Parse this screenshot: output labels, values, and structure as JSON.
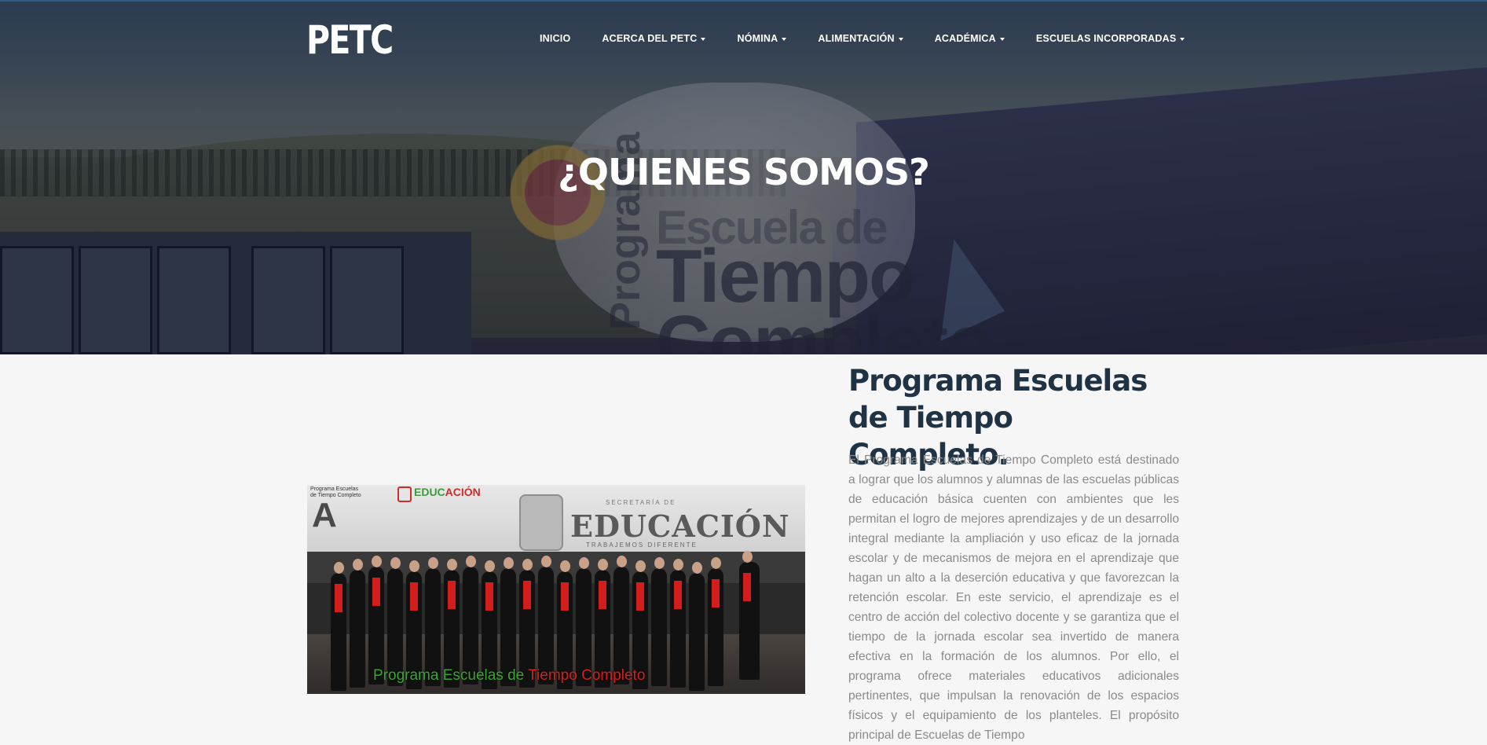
{
  "header": {
    "logo": "PETC",
    "nav": [
      {
        "label": "INICIO",
        "dropdown": false
      },
      {
        "label": "ACERCA DEL PETC",
        "dropdown": true
      },
      {
        "label": "NÓMINA",
        "dropdown": true
      },
      {
        "label": "ALIMENTACIÓN",
        "dropdown": true
      },
      {
        "label": "ACADÉMICA",
        "dropdown": true
      },
      {
        "label": "ESCUELAS INCORPORADAS",
        "dropdown": true
      }
    ]
  },
  "hero": {
    "heading": "¿QUIENES SOMOS?",
    "sign_line1": "Escuela de",
    "sign_line2": "Tiempo",
    "sign_line3": "Completo",
    "sign_side": "Programa"
  },
  "photo": {
    "brand_text_green": "EDUC",
    "brand_text_red": "ACIÓN",
    "corner_label": "Programa Escuelas de Tiempo Completo",
    "letter": "A",
    "secretaria": "SECRETARÍA DE",
    "building_sign": "EDUCACIÓN",
    "building_subtitle": "TRABAJEMOS DIFERENTE",
    "caption_green": "Programa Escuelas de",
    "caption_red": "Tiempo Completo"
  },
  "intro": {
    "title_line1": "Programa Escuelas",
    "title_line2": "de Tiempo Completo.",
    "body": "El Programa Escuelas de Tiempo Completo está destinado a lograr que los alumnos y alumnas de las escuelas públicas de educación básica cuenten con ambientes que les permitan el logro de mejores aprendizajes y de un desarrollo integral mediante la ampliación y uso eficaz de la jornada escolar y de mecanismos de mejora en el aprendizaje que hagan un alto a la deserción educativa y que favorezcan la retención escolar. En este servicio, el aprendizaje es el centro de acción del colectivo docente y se garantiza que el tiempo de la jornada escolar sea invertido de manera efectiva en la formación de los alumnos. Por ello, el programa ofrece materiales educativos adicionales pertinentes, que impulsan la renovación de los espacios físicos y el equipamiento de los planteles. El propósito principal de Escuelas de Tiempo"
  },
  "colors": {
    "title": "#1f3345",
    "body_text": "#8a8a8a",
    "background": "#f6f6f6",
    "nav_text": "#ffffff"
  }
}
